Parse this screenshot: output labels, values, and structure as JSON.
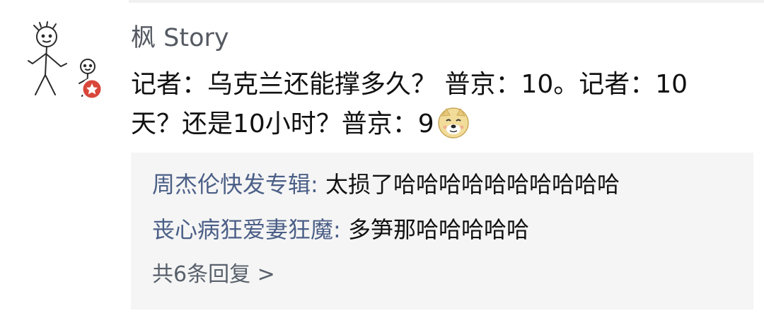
{
  "post": {
    "author": "枫 Story",
    "content_line1": "记者：乌克兰还能撑多久？ 普京：10。记者：10",
    "content_line2": "天？还是10小时？普京：9",
    "emoji_icon": "doge-icon"
  },
  "replies": [
    {
      "name": "周杰伦快发专辑:",
      "text": " 太损了哈哈哈哈哈哈哈哈哈哈"
    },
    {
      "name": "丧心病狂爱妻狂魔:",
      "text": " 多笋那哈哈哈哈哈"
    }
  ],
  "more_replies": "共6条回复 >",
  "colors": {
    "author": "#555a62",
    "reply_name": "#4b5f87",
    "reply_bg": "#f5f5f5",
    "more_link": "#58606b"
  },
  "icons": [
    "avatar-stick-figure-icon",
    "badge-icon",
    "doge-icon"
  ]
}
